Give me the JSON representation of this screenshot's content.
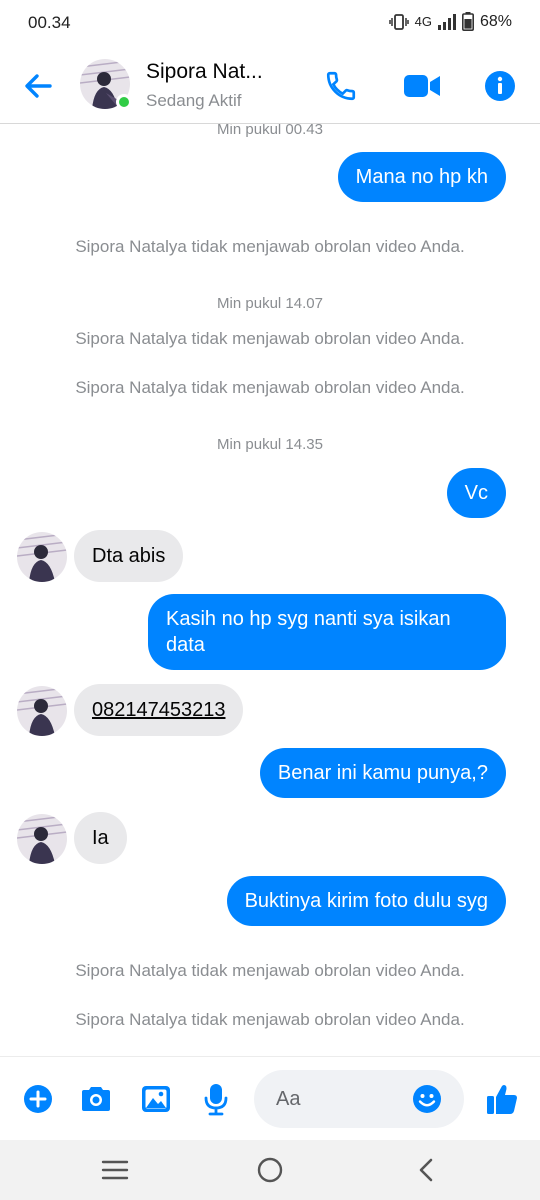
{
  "status_bar": {
    "time": "00.34",
    "network": "4G",
    "battery": "68%"
  },
  "header": {
    "contact_name": "Sipora Nat...",
    "contact_status": "Sedang Aktif",
    "icons": [
      "back-arrow-icon",
      "phone-icon",
      "video-camera-icon",
      "info-icon"
    ],
    "accent_color": "#0084ff",
    "online_color": "#31cc46"
  },
  "messages": {
    "ts1": "Min pukul 00.43",
    "out1": "Mana no hp kh",
    "sys1": "Sipora Natalya tidak menjawab obrolan video Anda.",
    "ts2": "Min pukul 14.07",
    "sys2": "Sipora Natalya tidak menjawab obrolan video Anda.",
    "sys3": "Sipora Natalya tidak menjawab obrolan video Anda.",
    "ts3": "Min pukul 14.35",
    "out2": "Vc",
    "in1": "Dta abis",
    "out3": "Kasih no hp syg nanti sya isikan data",
    "in2": "082147453213",
    "out4": "Benar ini kamu punya,?",
    "in3": "Ia",
    "out5": "Buktinya kirim foto dulu syg",
    "sys4": "Sipora Natalya tidak menjawab obrolan video Anda.",
    "sys5": "Sipora Natalya tidak menjawab obrolan video Anda."
  },
  "composer": {
    "placeholder": "Aa",
    "icons": [
      "plus-icon",
      "camera-icon",
      "gallery-icon",
      "microphone-icon",
      "emoji-icon",
      "thumbs-up-icon"
    ]
  },
  "navbar": {
    "icons": [
      "recent-apps-icon",
      "home-icon",
      "back-icon"
    ]
  }
}
